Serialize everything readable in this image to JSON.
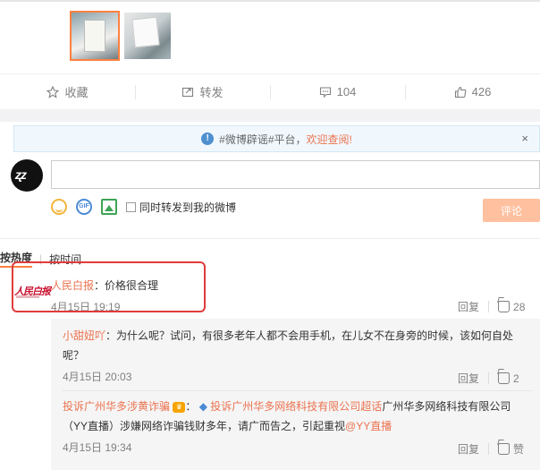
{
  "toolbar": {
    "favorite_label": "收藏",
    "repost_label": "转发",
    "comment_count": "104",
    "like_count": "426"
  },
  "notice": {
    "prefix": "#微博辟谣#平台，",
    "link": "欢迎查阅!",
    "close": "×"
  },
  "composer": {
    "repost_option": "同时转发到我的微博",
    "submit_label": "评论",
    "gif_label": "GIF"
  },
  "sort": {
    "hot": "按热度",
    "time": "按时间"
  },
  "comments": [
    {
      "user": "人民白报",
      "text": "：价格很合理",
      "time": "4月15日 19:19",
      "reply": "回复",
      "likes": "28"
    }
  ],
  "replies": [
    {
      "user": "小甜妞吖",
      "text": "：为什么呢？试问，有很多老年人都不会用手机，在儿女不在身旁的时候，该如何自处呢？",
      "time": "4月15日 20:03",
      "reply": "回复",
      "likes": "2"
    },
    {
      "user": "投诉广州华多涉黄诈骗",
      "sep": "：",
      "link": "投诉广州华多网络科技有限公司超话",
      "text": "广州华多网络科技有限公司（YY直播）涉嫌网络诈骗钱财多年，请广而告之，引起重视",
      "mention": "@YY直播",
      "time": "4月15日 19:34",
      "reply": "回复",
      "likes": "赞"
    }
  ],
  "colors": {
    "accent": "#eb7350",
    "highlight": "#e03b3b",
    "submit": "#ffc09f"
  }
}
